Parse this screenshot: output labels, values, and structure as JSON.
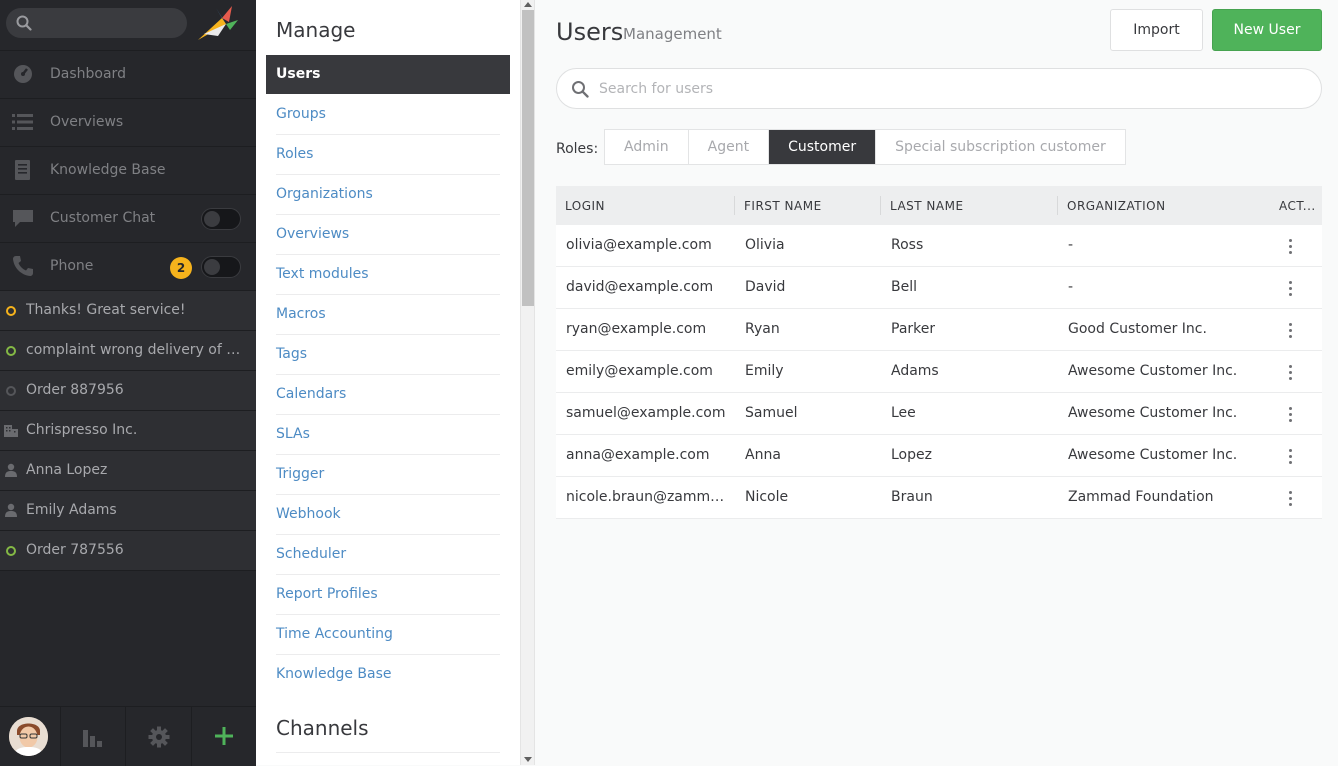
{
  "nav": {
    "search_placeholder": "",
    "main_items": [
      {
        "label": "Dashboard",
        "icon": "dashboard-icon"
      },
      {
        "label": "Overviews",
        "icon": "list-icon"
      },
      {
        "label": "Knowledge Base",
        "icon": "book-icon"
      },
      {
        "label": "Customer Chat",
        "icon": "chat-icon"
      },
      {
        "label": "Phone",
        "icon": "phone-icon",
        "badge": "2"
      }
    ],
    "tasks": [
      {
        "label": "Thanks! Great service!",
        "icon": "ticket-open-icon"
      },
      {
        "label": "complaint wrong delivery of order",
        "icon": "ticket-new-icon"
      },
      {
        "label": "Order 887956",
        "icon": "ticket-closed-icon"
      },
      {
        "label": "Chrispresso Inc.",
        "icon": "organization-icon"
      },
      {
        "label": "Anna Lopez",
        "icon": "user-icon"
      },
      {
        "label": "Emily Adams",
        "icon": "user-icon"
      },
      {
        "label": "Order 787556",
        "icon": "ticket-new-icon"
      }
    ]
  },
  "manage": {
    "title": "Manage",
    "items": [
      "Users",
      "Groups",
      "Roles",
      "Organizations",
      "Overviews",
      "Text modules",
      "Macros",
      "Tags",
      "Calendars",
      "SLAs",
      "Trigger",
      "Webhook",
      "Scheduler",
      "Report Profiles",
      "Time Accounting",
      "Knowledge Base"
    ],
    "channels_title": "Channels"
  },
  "page": {
    "title": "Users",
    "subtitle": "Management",
    "import_label": "Import",
    "new_user_label": "New User",
    "search_placeholder": "Search for users",
    "roles_label": "Roles:",
    "roles": [
      "Admin",
      "Agent",
      "Customer",
      "Special subscription customer"
    ],
    "active_role": "Customer"
  },
  "table": {
    "columns": [
      "LOGIN",
      "FIRST NAME",
      "LAST NAME",
      "ORGANIZATION",
      "ACT..."
    ],
    "rows": [
      [
        "olivia@example.com",
        "Olivia",
        "Ross",
        "-"
      ],
      [
        "david@example.com",
        "David",
        "Bell",
        "-"
      ],
      [
        "ryan@example.com",
        "Ryan",
        "Parker",
        "Good Customer Inc."
      ],
      [
        "emily@example.com",
        "Emily",
        "Adams",
        "Awesome Customer Inc."
      ],
      [
        "samuel@example.com",
        "Samuel",
        "Lee",
        "Awesome Customer Inc."
      ],
      [
        "anna@example.com",
        "Anna",
        "Lopez",
        "Awesome Customer Inc."
      ],
      [
        "nicole.braun@zammad...",
        "Nicole",
        "Braun",
        "Zammad Foundation"
      ]
    ]
  },
  "colors": {
    "nav_bg": "#26272b",
    "accent_green": "#4fb35a",
    "link_blue": "#4d8bc4",
    "badge_yellow": "#f6b31c"
  }
}
